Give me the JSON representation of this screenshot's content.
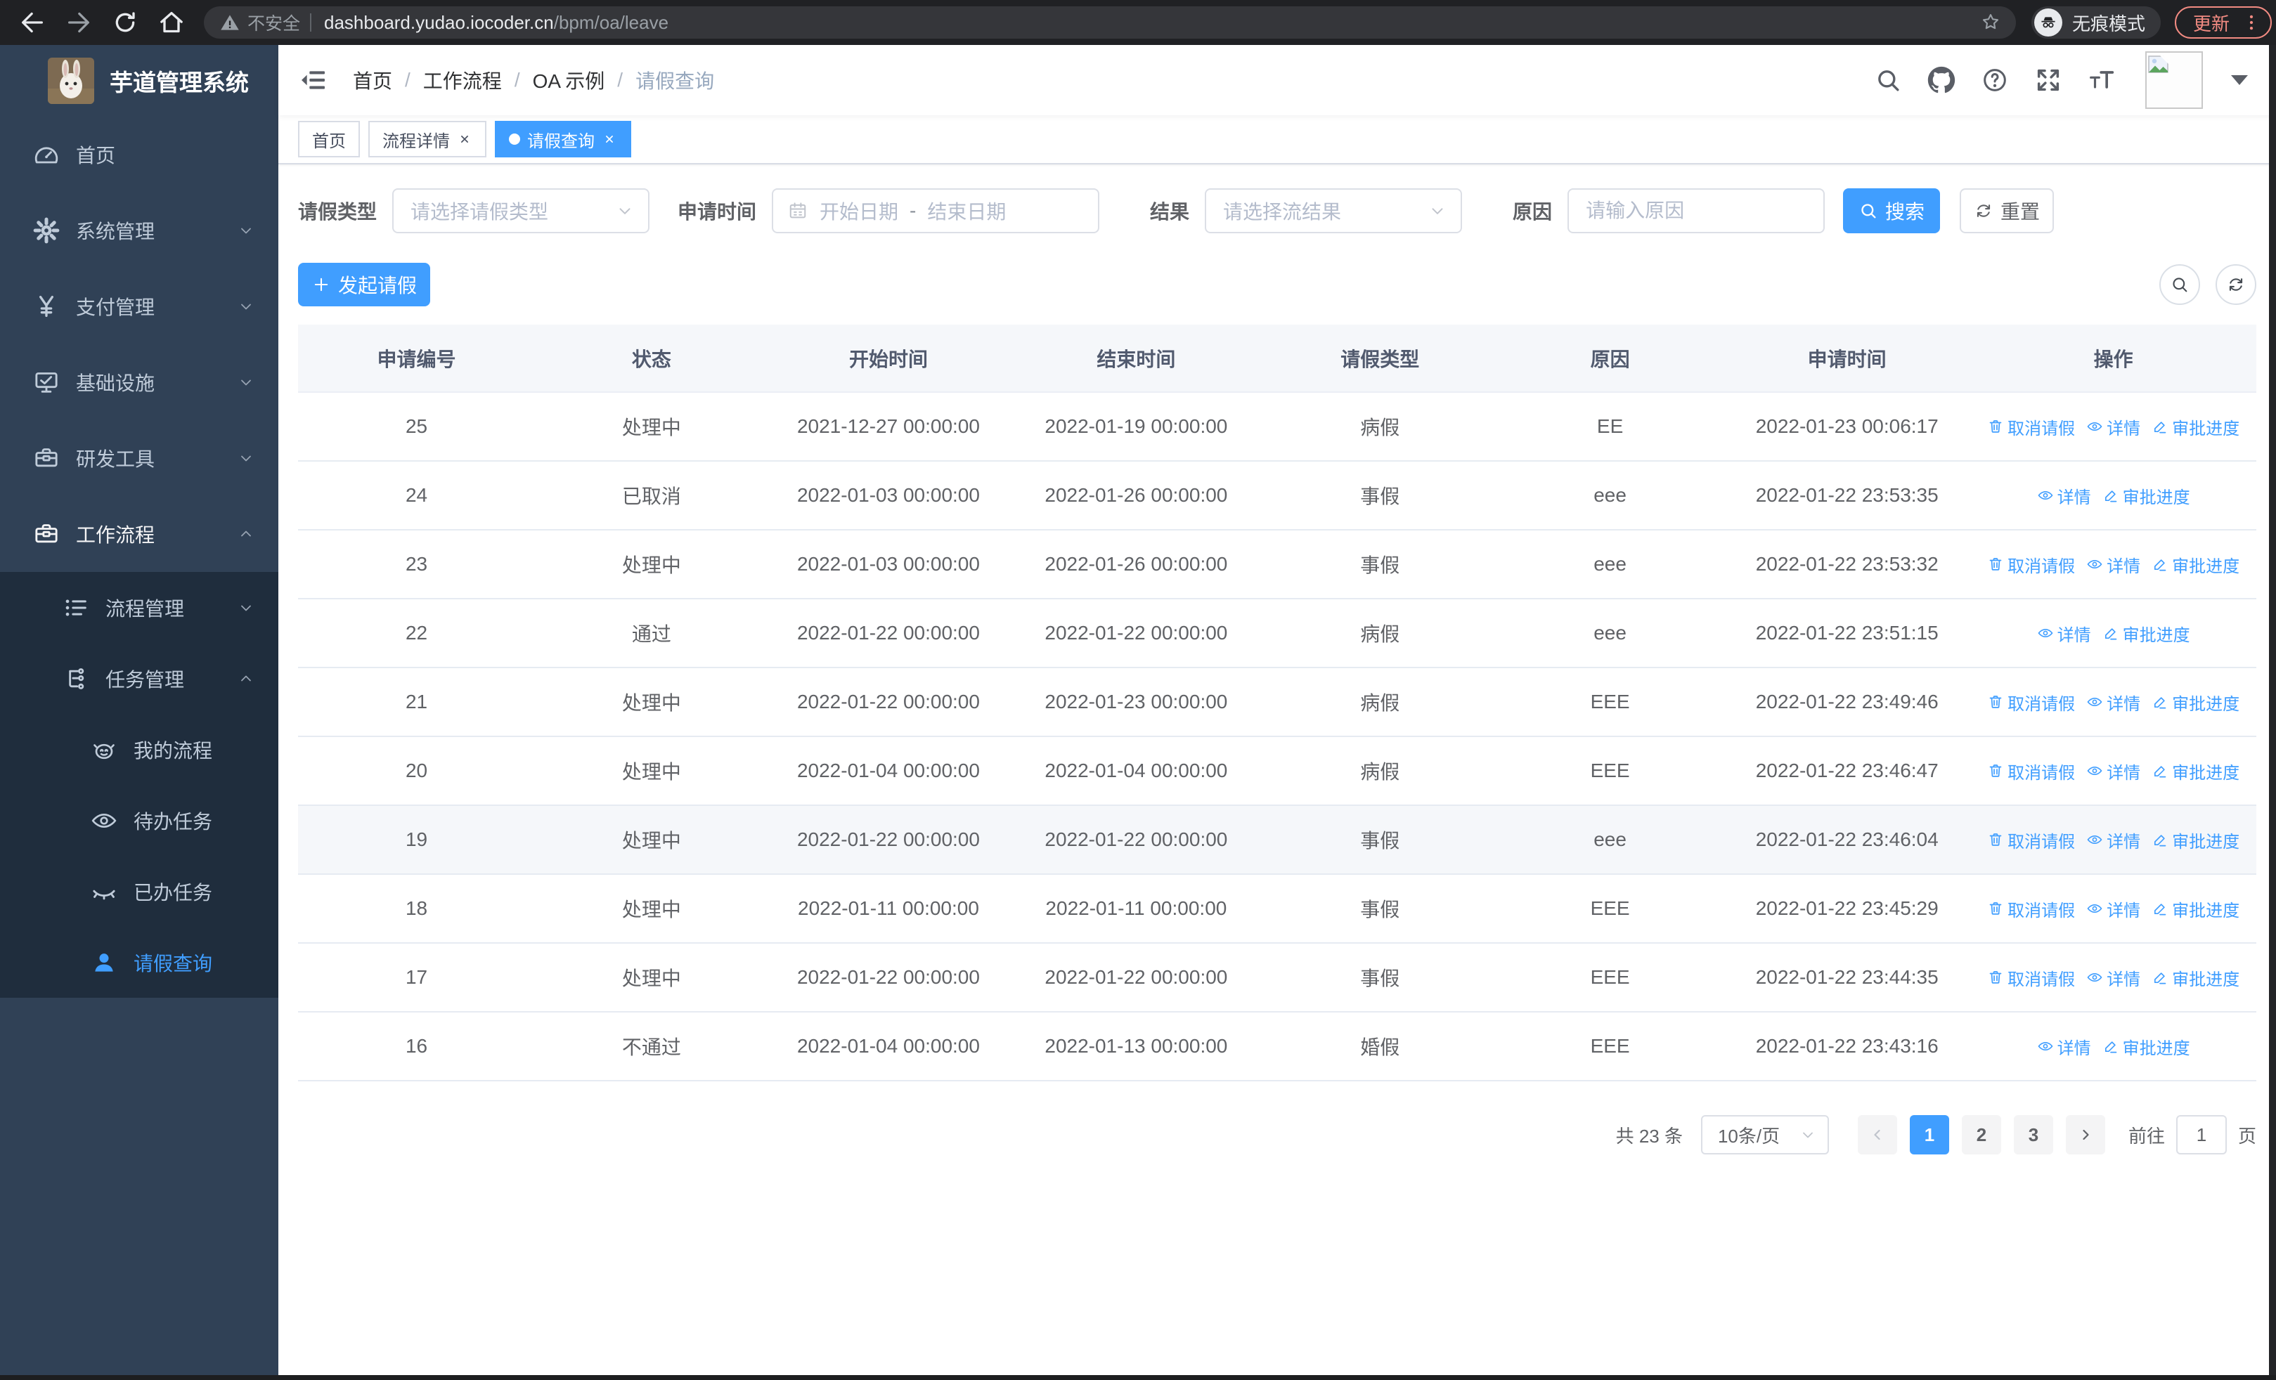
{
  "colors": {
    "accent": "#409eff",
    "sidebar_bg": "#304156",
    "submenu_bg": "#1f2d3d",
    "chrome_bg": "#202124",
    "danger": "#f28b82"
  },
  "browser": {
    "security_label": "不安全",
    "url_host": "dashboard.yudao.iocoder.cn",
    "url_path": "/bpm/oa/leave",
    "incognito_label": "无痕模式",
    "update_label": "更新"
  },
  "sidebar": {
    "title": "芋道管理系统",
    "items": [
      {
        "name": "home",
        "label": "首页",
        "icon": "dashboard-icon"
      },
      {
        "name": "system-mgmt",
        "label": "系统管理",
        "icon": "gear-icon",
        "arrow": "down"
      },
      {
        "name": "payment-mgmt",
        "label": "支付管理",
        "icon": "yen-icon",
        "arrow": "down"
      },
      {
        "name": "infrastructure",
        "label": "基础设施",
        "icon": "monitor-icon",
        "arrow": "down"
      },
      {
        "name": "dev-tools",
        "label": "研发工具",
        "icon": "toolbox-icon",
        "arrow": "down"
      },
      {
        "name": "workflow",
        "label": "工作流程",
        "icon": "workflow-icon",
        "arrow": "up",
        "expanded": true,
        "children": [
          {
            "name": "process-mgmt",
            "label": "流程管理",
            "icon": "list-icon",
            "arrow": "down",
            "level": 2
          },
          {
            "name": "task-mgmt",
            "label": "任务管理",
            "icon": "tasks-icon",
            "arrow": "up",
            "level": 2
          },
          {
            "name": "my-process",
            "label": "我的流程",
            "icon": "robot-icon",
            "level": 3
          },
          {
            "name": "todo-tasks",
            "label": "待办任务",
            "icon": "eye-icon",
            "level": 3
          },
          {
            "name": "done-tasks",
            "label": "已办任务",
            "icon": "eye-closed-icon",
            "level": 3
          },
          {
            "name": "leave-query",
            "label": "请假查询",
            "icon": "user-icon",
            "level": 3,
            "active": true
          }
        ]
      }
    ]
  },
  "header": {
    "breadcrumb": [
      {
        "label": "首页"
      },
      {
        "label": "工作流程"
      },
      {
        "label": "OA 示例"
      },
      {
        "label": "请假查询",
        "current": true
      }
    ]
  },
  "tabs": [
    {
      "label": "首页",
      "closable": false,
      "active": false
    },
    {
      "label": "流程详情",
      "closable": true,
      "active": false
    },
    {
      "label": "请假查询",
      "closable": true,
      "active": true
    }
  ],
  "filters": {
    "leave_type": {
      "label": "请假类型",
      "placeholder": "请选择请假类型"
    },
    "apply_time": {
      "label": "申请时间",
      "start_placeholder": "开始日期",
      "separator": "-",
      "end_placeholder": "结束日期"
    },
    "result": {
      "label": "结果",
      "placeholder": "请选择流结果"
    },
    "reason": {
      "label": "原因",
      "placeholder": "请输入原因"
    },
    "search_label": "搜索",
    "reset_label": "重置"
  },
  "toolbar": {
    "create_label": "发起请假"
  },
  "table": {
    "columns": [
      "申请编号",
      "状态",
      "开始时间",
      "结束时间",
      "请假类型",
      "原因",
      "申请时间",
      "操作"
    ],
    "action_labels": {
      "cancel": "取消请假",
      "detail": "详情",
      "progress": "审批进度"
    },
    "rows": [
      {
        "id": "25",
        "status": "处理中",
        "start": "2021-12-27 00:00:00",
        "end": "2022-01-19 00:00:00",
        "type": "病假",
        "reason": "EE",
        "applied": "2022-01-23 00:06:17",
        "actions": [
          "cancel",
          "detail",
          "progress"
        ]
      },
      {
        "id": "24",
        "status": "已取消",
        "start": "2022-01-03 00:00:00",
        "end": "2022-01-26 00:00:00",
        "type": "事假",
        "reason": "eee",
        "applied": "2022-01-22 23:53:35",
        "actions": [
          "detail",
          "progress"
        ]
      },
      {
        "id": "23",
        "status": "处理中",
        "start": "2022-01-03 00:00:00",
        "end": "2022-01-26 00:00:00",
        "type": "事假",
        "reason": "eee",
        "applied": "2022-01-22 23:53:32",
        "actions": [
          "cancel",
          "detail",
          "progress"
        ]
      },
      {
        "id": "22",
        "status": "通过",
        "start": "2022-01-22 00:00:00",
        "end": "2022-01-22 00:00:00",
        "type": "病假",
        "reason": "eee",
        "applied": "2022-01-22 23:51:15",
        "actions": [
          "detail",
          "progress"
        ]
      },
      {
        "id": "21",
        "status": "处理中",
        "start": "2022-01-22 00:00:00",
        "end": "2022-01-23 00:00:00",
        "type": "病假",
        "reason": "EEE",
        "applied": "2022-01-22 23:49:46",
        "actions": [
          "cancel",
          "detail",
          "progress"
        ]
      },
      {
        "id": "20",
        "status": "处理中",
        "start": "2022-01-04 00:00:00",
        "end": "2022-01-04 00:00:00",
        "type": "病假",
        "reason": "EEE",
        "applied": "2022-01-22 23:46:47",
        "actions": [
          "cancel",
          "detail",
          "progress"
        ]
      },
      {
        "id": "19",
        "status": "处理中",
        "start": "2022-01-22 00:00:00",
        "end": "2022-01-22 00:00:00",
        "type": "事假",
        "reason": "eee",
        "applied": "2022-01-22 23:46:04",
        "actions": [
          "cancel",
          "detail",
          "progress"
        ],
        "highlight": true
      },
      {
        "id": "18",
        "status": "处理中",
        "start": "2022-01-11 00:00:00",
        "end": "2022-01-11 00:00:00",
        "type": "事假",
        "reason": "EEE",
        "applied": "2022-01-22 23:45:29",
        "actions": [
          "cancel",
          "detail",
          "progress"
        ]
      },
      {
        "id": "17",
        "status": "处理中",
        "start": "2022-01-22 00:00:00",
        "end": "2022-01-22 00:00:00",
        "type": "事假",
        "reason": "EEE",
        "applied": "2022-01-22 23:44:35",
        "actions": [
          "cancel",
          "detail",
          "progress"
        ]
      },
      {
        "id": "16",
        "status": "不通过",
        "start": "2022-01-04 00:00:00",
        "end": "2022-01-13 00:00:00",
        "type": "婚假",
        "reason": "EEE",
        "applied": "2022-01-22 23:43:16",
        "actions": [
          "detail",
          "progress"
        ]
      }
    ]
  },
  "pagination": {
    "total": "共 23 条",
    "page_size": "10条/页",
    "pages": [
      "1",
      "2",
      "3"
    ],
    "active_page": "1",
    "goto_label": "前往",
    "goto_value": "1",
    "unit_label": "页"
  }
}
